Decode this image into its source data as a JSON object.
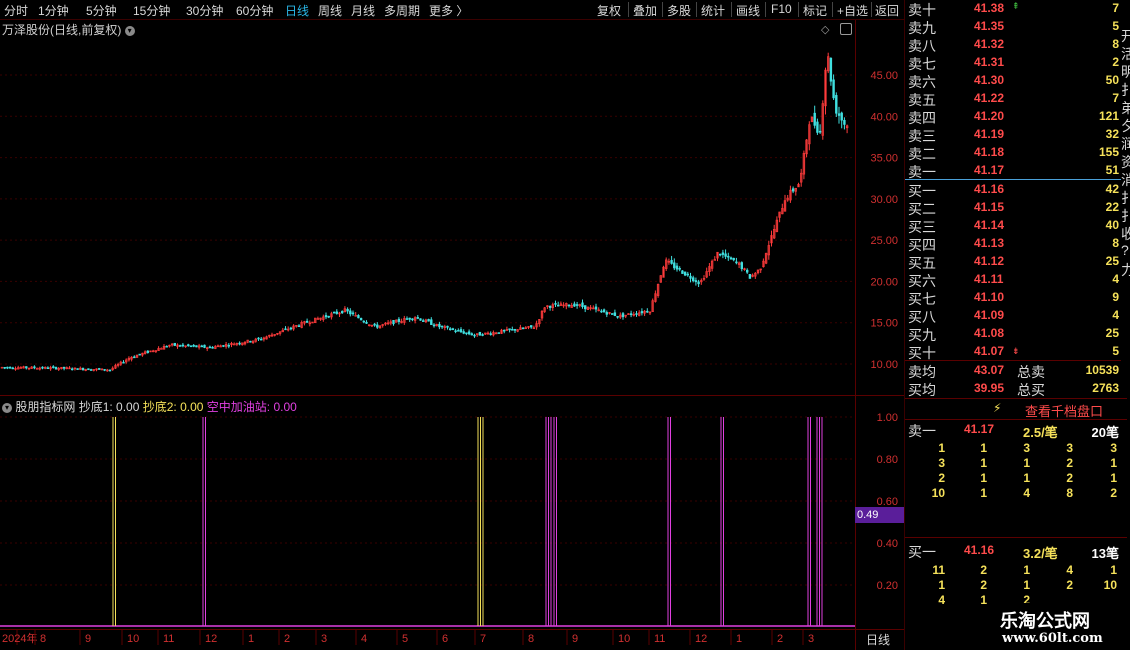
{
  "toolbar": {
    "periods": [
      "分时",
      "1分钟",
      "5分钟",
      "15分钟",
      "30分钟",
      "60分钟",
      "日线",
      "周线",
      "月线",
      "多周期",
      "更多 〉"
    ],
    "active_period": "日线",
    "right_items": [
      "复权",
      "叠加",
      "多股",
      "统计",
      "画线",
      "F10",
      "标记",
      "+自选",
      "返回"
    ]
  },
  "main_chart": {
    "title": "万泽股份(日线,前复权)",
    "y_ticks": [
      "45.00",
      "40.00",
      "35.00",
      "30.00",
      "25.00",
      "20.00",
      "15.00",
      "10.00"
    ],
    "colors": {
      "up": "#ff3b3b",
      "down": "#40e0e0",
      "grid": "#3a0000"
    }
  },
  "indicator": {
    "name": "股朋指标网",
    "items": [
      {
        "label": "抄底1: 0.00",
        "color": "#d8d8d8"
      },
      {
        "label": "抄底2: 0.00",
        "color": "#f5e15a"
      },
      {
        "label": "空中加油站: 0.00",
        "color": "#e040e0"
      }
    ],
    "y_ticks": [
      "1.00",
      "0.80",
      "0.60",
      "0.40",
      "0.20"
    ],
    "cursor_value": "0.49"
  },
  "x_axis": {
    "labels": [
      "2024年",
      "8",
      "9",
      "10",
      "11",
      "12",
      "1",
      "2",
      "3",
      "4",
      "5",
      "6",
      "7",
      "8",
      "9",
      "10",
      "11",
      "12",
      "1",
      "2",
      "3"
    ],
    "period_label": "日线"
  },
  "order_book": {
    "sells": [
      {
        "label": "卖十",
        "price": "41.38",
        "qty": "7"
      },
      {
        "label": "卖九",
        "price": "41.35",
        "qty": "5"
      },
      {
        "label": "卖八",
        "price": "41.32",
        "qty": "8"
      },
      {
        "label": "卖七",
        "price": "41.31",
        "qty": "2"
      },
      {
        "label": "卖六",
        "price": "41.30",
        "qty": "50"
      },
      {
        "label": "卖五",
        "price": "41.22",
        "qty": "7"
      },
      {
        "label": "卖四",
        "price": "41.20",
        "qty": "121"
      },
      {
        "label": "卖三",
        "price": "41.19",
        "qty": "32"
      },
      {
        "label": "卖二",
        "price": "41.18",
        "qty": "155"
      },
      {
        "label": "卖一",
        "price": "41.17",
        "qty": "51"
      }
    ],
    "buys": [
      {
        "label": "买一",
        "price": "41.16",
        "qty": "42"
      },
      {
        "label": "买二",
        "price": "41.15",
        "qty": "22"
      },
      {
        "label": "买三",
        "price": "41.14",
        "qty": "40"
      },
      {
        "label": "买四",
        "price": "41.13",
        "qty": "8"
      },
      {
        "label": "买五",
        "price": "41.12",
        "qty": "25"
      },
      {
        "label": "买六",
        "price": "41.11",
        "qty": "4"
      },
      {
        "label": "买七",
        "price": "41.10",
        "qty": "9"
      },
      {
        "label": "买八",
        "price": "41.09",
        "qty": "4"
      },
      {
        "label": "买九",
        "price": "41.08",
        "qty": "25"
      },
      {
        "label": "买十",
        "price": "41.07",
        "qty": "5"
      }
    ],
    "avg_sell": {
      "label": "卖均",
      "price": "43.07",
      "total_label": "总卖",
      "total": "10539"
    },
    "avg_buy": {
      "label": "买均",
      "price": "39.95",
      "total_label": "总买",
      "total": "2763"
    },
    "thousand_label": "查看千档盘口",
    "sell1": {
      "label": "卖一",
      "price": "41.17",
      "per": "2.5/笔",
      "count": "20笔"
    },
    "sell1_queue": [
      [
        "1",
        "1",
        "3",
        "3",
        "3"
      ],
      [
        "3",
        "1",
        "1",
        "2",
        "1"
      ],
      [
        "2",
        "1",
        "1",
        "2",
        "1"
      ],
      [
        "10",
        "1",
        "4",
        "8",
        "2"
      ]
    ],
    "buy1": {
      "label": "买一",
      "price": "41.16",
      "per": "3.2/笔",
      "count": "13笔"
    },
    "buy1_queue": [
      [
        "11",
        "2",
        "1",
        "4",
        "1"
      ],
      [
        "1",
        "2",
        "1",
        "2",
        "10"
      ],
      [
        "4",
        "1",
        "2",
        "",
        ""
      ]
    ]
  },
  "side_strip_chars": [
    "开",
    "活",
    "明",
    "扌",
    "弟",
    "夕",
    "润",
    "资",
    "消",
    "扌",
    "扌",
    "收",
    "?",
    "力"
  ],
  "watermark": {
    "line1": "乐淘公式网",
    "line2": "www.60lt.com"
  }
}
